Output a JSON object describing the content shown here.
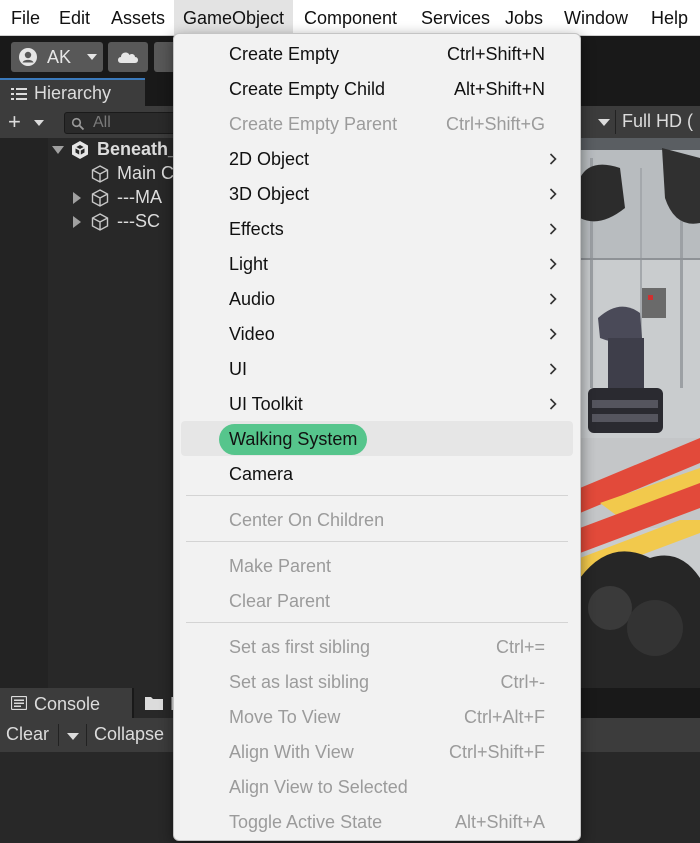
{
  "menubar": {
    "items": [
      "File",
      "Edit",
      "Assets",
      "GameObject",
      "Component",
      "Services",
      "Jobs",
      "Window",
      "Help"
    ],
    "active": "GameObject"
  },
  "toolbar": {
    "account_label": "AK",
    "account_icon": "user-icon",
    "cloud_icon": "cloud-icon"
  },
  "hierarchy": {
    "tab_label": "Hierarchy",
    "search_placeholder": "All",
    "scene_name": "Beneath_",
    "items": [
      {
        "label": "Main C",
        "icon": "cube-icon"
      },
      {
        "label": "---MA",
        "icon": "cube-icon"
      },
      {
        "label": "---SC",
        "icon": "cube-icon"
      }
    ]
  },
  "scene_view": {
    "resolution_label": "Full HD ("
  },
  "console": {
    "tab_label": "Console",
    "project_tab_label": "P",
    "clear_label": "Clear",
    "collapse_label": "Collapse"
  },
  "gameobject_menu": {
    "highlight_color": "#56c58c",
    "items": [
      {
        "label": "Create Empty",
        "shortcut": "Ctrl+Shift+N",
        "disabled": false
      },
      {
        "label": "Create Empty Child",
        "shortcut": "Alt+Shift+N",
        "disabled": false
      },
      {
        "label": "Create Empty Parent",
        "shortcut": "Ctrl+Shift+G",
        "disabled": true
      },
      {
        "label": "2D Object",
        "submenu": true
      },
      {
        "label": "3D Object",
        "submenu": true
      },
      {
        "label": "Effects",
        "submenu": true
      },
      {
        "label": "Light",
        "submenu": true
      },
      {
        "label": "Audio",
        "submenu": true
      },
      {
        "label": "Video",
        "submenu": true
      },
      {
        "label": "UI",
        "submenu": true
      },
      {
        "label": "UI Toolkit",
        "submenu": true
      },
      {
        "label": "Walking System",
        "highlighted": true
      },
      {
        "label": "Camera"
      },
      {
        "label": "Center On Children",
        "disabled": true
      },
      {
        "label": "Make Parent",
        "disabled": true
      },
      {
        "label": "Clear Parent",
        "disabled": true
      },
      {
        "label": "Set as first sibling",
        "shortcut": "Ctrl+=",
        "disabled": true
      },
      {
        "label": "Set as last sibling",
        "shortcut": "Ctrl+-",
        "disabled": true
      },
      {
        "label": "Move To View",
        "shortcut": "Ctrl+Alt+F",
        "disabled": true
      },
      {
        "label": "Align With View",
        "shortcut": "Ctrl+Shift+F",
        "disabled": true
      },
      {
        "label": "Align View to Selected",
        "disabled": true
      },
      {
        "label": "Toggle Active State",
        "shortcut": "Alt+Shift+A",
        "disabled": true
      }
    ]
  }
}
